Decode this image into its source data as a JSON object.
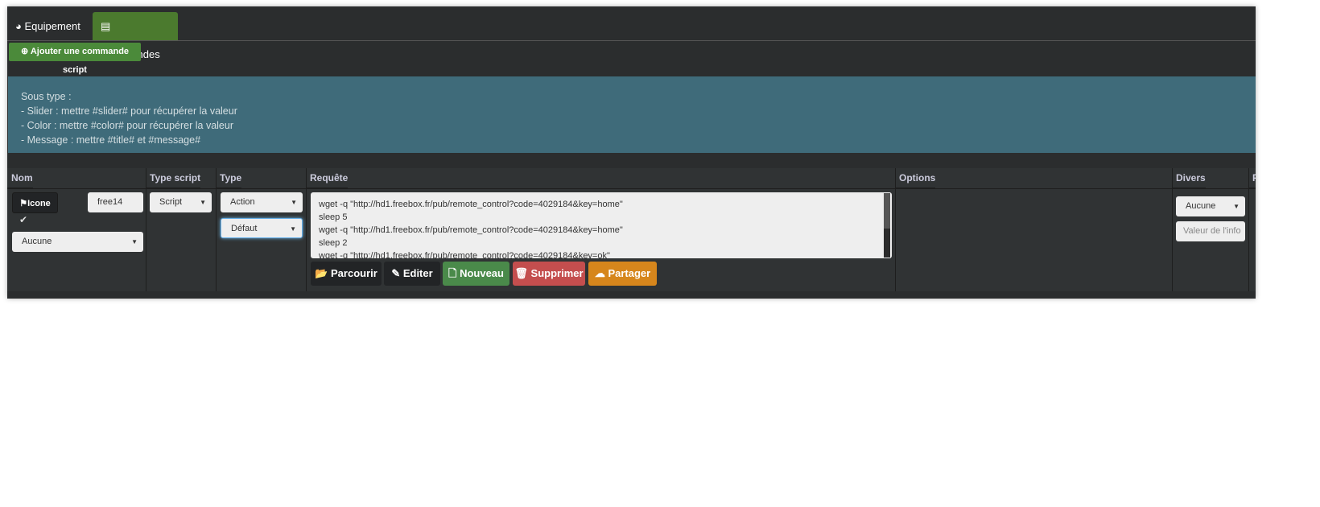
{
  "tabs": [
    {
      "label": "Equipement",
      "icon": "dashboard-icon"
    },
    {
      "label": "Commandes",
      "icon": "list-icon",
      "active": true
    }
  ],
  "add_button": "Ajouter une commande script",
  "info": {
    "lines": [
      "Sous type :",
      "- Slider : mettre #slider# pour récupérer la valeur",
      "- Color : mettre #color# pour récupérer la valeur",
      "- Message : mettre #title# et #message#"
    ],
    "background": "#3f6b7a"
  },
  "table": {
    "headers": [
      "Nom",
      "Type script",
      "Type",
      "Requête",
      "Options",
      "Divers",
      "P"
    ],
    "row": {
      "icon_button": "Icone",
      "name": "free14",
      "object_select": "Aucune",
      "type_script": "Script",
      "type": "Action",
      "subtype": "Défaut",
      "request": "wget -q \"http://hd1.freebox.fr/pub/remote_control?code=4029184&key=home\"\nsleep 5\nwget -q \"http://hd1.freebox.fr/pub/remote_control?code=4029184&key=home\"\nsleep 2\nwget -q \"http://hd1.freebox.fr/pub/remote_control?code=4029184&key=ok\"",
      "buttons": [
        {
          "label": "Parcourir",
          "color": "#222426"
        },
        {
          "label": "Editer",
          "color": "#222426"
        },
        {
          "label": "Nouveau",
          "color": "#4a8a4a"
        },
        {
          "label": "Supprimer",
          "color": "#c44e4e"
        },
        {
          "label": "Partager",
          "color": "#d6861c"
        }
      ],
      "divers_select": "Aucune",
      "divers_placeholder": "Valeur de l'info"
    }
  },
  "colors": {
    "active_tab": "#4b7a2e",
    "add_button": "#4b8a3a"
  }
}
